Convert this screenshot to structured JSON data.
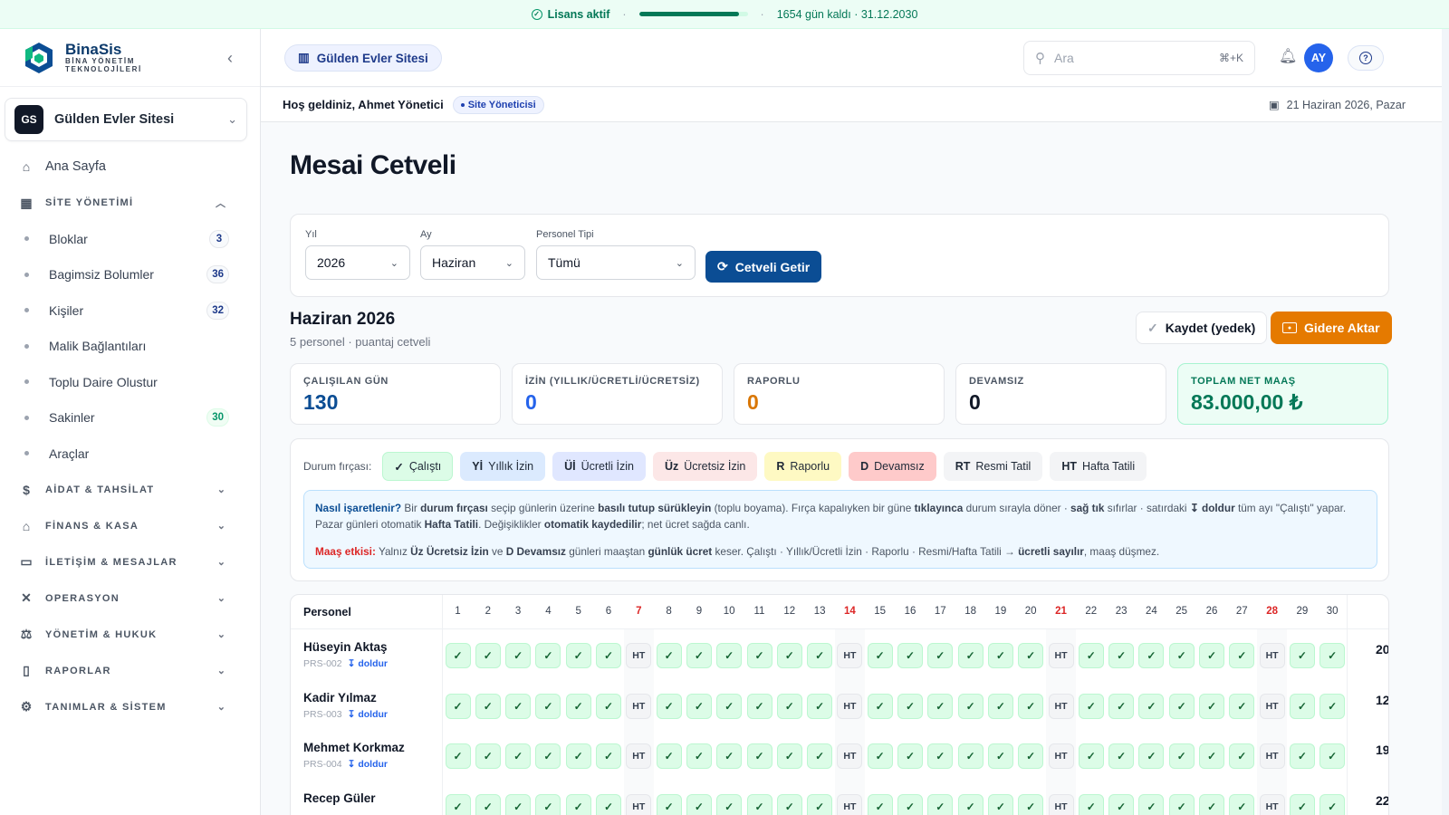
{
  "license": {
    "status": "Lisans aktif",
    "progress": 0.92,
    "remaining": "1654 gün kaldı · 31.12.2030"
  },
  "brand": {
    "name": "BinaSis",
    "tagline_1": "BİNA YÖNETİM",
    "tagline_2": "TEKNOLOJİLERİ"
  },
  "site_selector": {
    "initials": "GS",
    "name": "Gülden Evler Sitesi"
  },
  "nav": {
    "home": "Ana Sayfa",
    "site_management": "SİTE YÖNETİMİ",
    "sub": [
      {
        "label": "Bloklar",
        "count": "3"
      },
      {
        "label": "Bagimsiz Bolumler",
        "count": "36"
      },
      {
        "label": "Kişiler",
        "count": "32"
      },
      {
        "label": "Malik Bağlantıları",
        "count": ""
      },
      {
        "label": "Toplu Daire Olustur",
        "count": ""
      },
      {
        "label": "Sakinler",
        "count": "30"
      },
      {
        "label": "Araçlar",
        "count": ""
      }
    ],
    "sections": [
      "AİDAT & TAHSİLAT",
      "FİNANS & KASA",
      "İLETİŞİM & MESAJLAR",
      "OPERASYON",
      "YÖNETİM & HUKUK",
      "RAPORLAR",
      "TANIMLAR & SİSTEM"
    ]
  },
  "topbar": {
    "site_pill": "Gülden Evler Sitesi",
    "search_placeholder": "Ara",
    "search_shortcut": "⌘+K",
    "avatar": "AY"
  },
  "welcome": {
    "text": "Hoş geldiniz, Ahmet Yönetici",
    "role": "Site Yöneticisi",
    "date": "21 Haziran 2026, Pazar"
  },
  "page": {
    "title": "Mesai Cetveli"
  },
  "filters": {
    "year_label": "Yıl",
    "year": "2026",
    "month_label": "Ay",
    "month": "Haziran",
    "type_label": "Personel Tipi",
    "type": "Tümü",
    "fetch_button": "Cetveli Getir"
  },
  "period": {
    "title": "Haziran 2026",
    "subtitle": "5 personel · puantaj cetveli"
  },
  "actions": {
    "save": "Kaydet (yedek)",
    "export": "Gidere Aktar"
  },
  "stats": [
    {
      "label": "ÇALIŞILAN GÜN",
      "value": "130",
      "color": "#0b4d94"
    },
    {
      "label": "İZİN (YILLIK/ÜCRETLİ/ÜCRETSİZ)",
      "value": "0",
      "color": "#2563eb"
    },
    {
      "label": "RAPORLU",
      "value": "0",
      "color": "#d97706"
    },
    {
      "label": "DEVAMSIZ",
      "value": "0",
      "color": "#111827"
    },
    {
      "label": "TOPLAM NET MAAŞ",
      "value": "83.000,00 ₺",
      "color": "#047857"
    }
  ],
  "legend": {
    "label": "Durum fırçası:",
    "chips": [
      {
        "code": "✓",
        "text": "Çalıştı"
      },
      {
        "code": "Yİ",
        "text": "Yıllık İzin"
      },
      {
        "code": "Üİ",
        "text": "Ücretli İzin"
      },
      {
        "code": "Üz",
        "text": "Ücretsiz İzin"
      },
      {
        "code": "R",
        "text": "Raporlu"
      },
      {
        "code": "D",
        "text": "Devamsız"
      },
      {
        "code": "RT",
        "text": "Resmi Tatil"
      },
      {
        "code": "HT",
        "text": "Hafta Tatili"
      }
    ]
  },
  "info": {
    "p1": [
      {
        "t": "q",
        "v": "Nasıl işaretlenir?"
      },
      {
        "t": "n",
        "v": " Bir "
      },
      {
        "t": "s",
        "v": "durum fırçası"
      },
      {
        "t": "n",
        "v": " seçip günlerin üzerine "
      },
      {
        "t": "s",
        "v": "basılı tutup sürükleyin"
      },
      {
        "t": "n",
        "v": " (toplu boyama). Fırça kapalıyken bir güne "
      },
      {
        "t": "s",
        "v": "tıklayınca"
      },
      {
        "t": "n",
        "v": " durum sırayla döner · "
      },
      {
        "t": "s",
        "v": "sağ tık"
      },
      {
        "t": "n",
        "v": " sıfırlar · satırdaki "
      },
      {
        "t": "s",
        "v": "↧ doldur"
      },
      {
        "t": "n",
        "v": " tüm ayı \"Çalıştı\" yapar. Pazar günleri otomatik "
      },
      {
        "t": "s",
        "v": "Hafta Tatili"
      },
      {
        "t": "n",
        "v": ". Değişiklikler "
      },
      {
        "t": "s",
        "v": "otomatik kaydedilir"
      },
      {
        "t": "n",
        "v": "; net ücret sağda canlı."
      }
    ],
    "p2": [
      {
        "t": "m",
        "v": "Maaş etkisi:"
      },
      {
        "t": "n",
        "v": " Yalnız "
      },
      {
        "t": "s",
        "v": "Üz Ücretsiz İzin"
      },
      {
        "t": "n",
        "v": " ve "
      },
      {
        "t": "s",
        "v": "D Devamsız"
      },
      {
        "t": "n",
        "v": " günleri maaştan "
      },
      {
        "t": "s",
        "v": "günlük ücret"
      },
      {
        "t": "n",
        "v": " keser. Çalıştı · Yıllık/Ücretli İzin · Raporlu · Resmi/Hafta Tatili → "
      },
      {
        "t": "s",
        "v": "ücretli sayılır"
      },
      {
        "t": "n",
        "v": ", maaş düşmez."
      }
    ]
  },
  "table": {
    "personnel_header": "Personel",
    "days": [
      "1",
      "2",
      "3",
      "4",
      "5",
      "6",
      "7",
      "8",
      "9",
      "10",
      "11",
      "12",
      "13",
      "14",
      "15",
      "16",
      "17",
      "18",
      "19",
      "20",
      "21",
      "22",
      "23",
      "24",
      "25",
      "26",
      "27",
      "28",
      "29",
      "30"
    ],
    "weekend_days": [
      7,
      14,
      21,
      28
    ],
    "fill_label": "↧ doldur",
    "rows": [
      {
        "name": "Hüseyin Aktaş",
        "code": "PRS-002",
        "total": "20"
      },
      {
        "name": "Kadir Yılmaz",
        "code": "PRS-003",
        "total": "12"
      },
      {
        "name": "Mehmet Korkmaz",
        "code": "PRS-004",
        "total": "19"
      },
      {
        "name": "Recep Güler",
        "code": "",
        "total": "22"
      }
    ]
  }
}
